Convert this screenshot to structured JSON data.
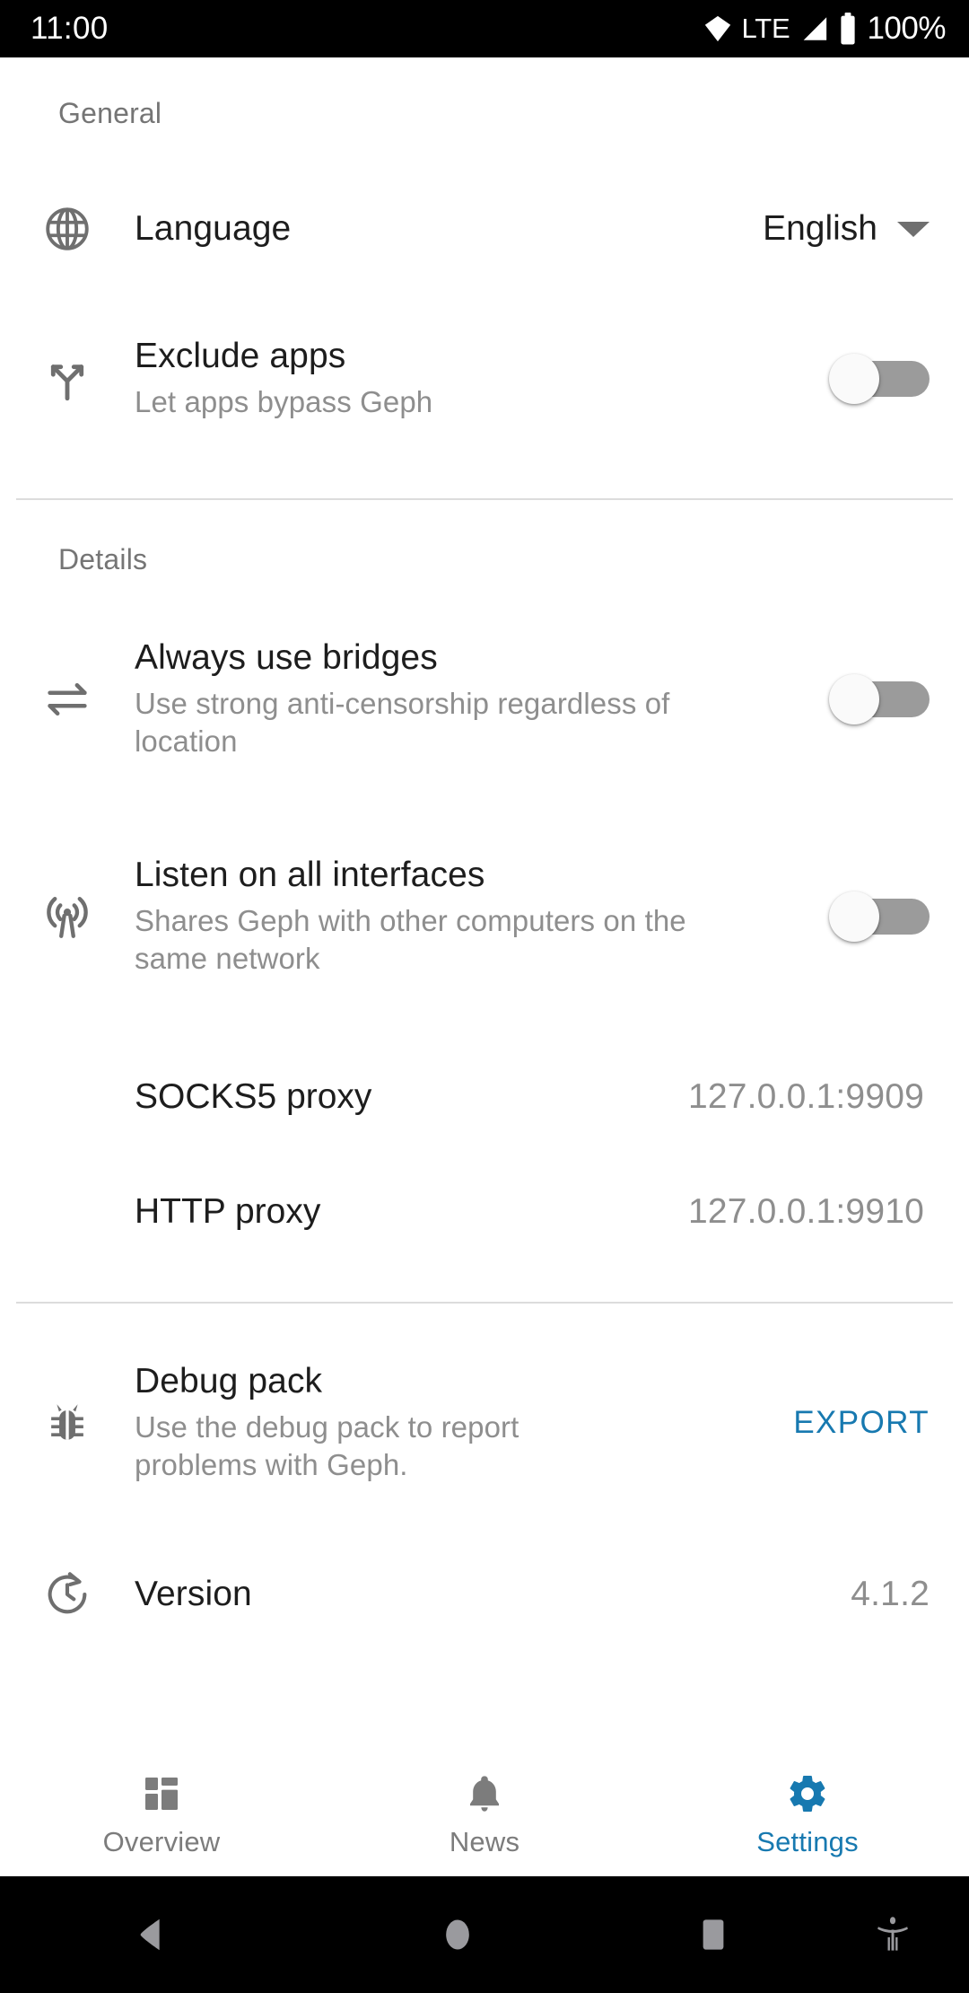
{
  "status_bar": {
    "time": "11:00",
    "network_type": "LTE",
    "battery_percent": "100%",
    "icons": [
      "wifi-icon",
      "signal-icon",
      "battery-icon"
    ]
  },
  "sections": [
    {
      "label": "General",
      "rows": [
        {
          "icon": "globe-icon",
          "title": "Language",
          "value": "English",
          "control": "dropdown"
        },
        {
          "icon": "call-split-icon",
          "title": "Exclude apps",
          "subtitle": "Let apps bypass Geph",
          "control": "switch",
          "checked": false
        }
      ]
    },
    {
      "label": "Details",
      "rows": [
        {
          "icon": "swap-horizontal-icon",
          "title": "Always use bridges",
          "subtitle": "Use strong anti-censorship regardless of location",
          "control": "switch",
          "checked": false
        },
        {
          "icon": "broadcast-icon",
          "title": "Listen on all interfaces",
          "subtitle": "Shares Geph with other computers on the same network",
          "control": "switch",
          "checked": false
        },
        {
          "title": "SOCKS5 proxy",
          "value": "127.0.0.1:9909",
          "control": "text"
        },
        {
          "title": "HTTP proxy",
          "value": "127.0.0.1:9910",
          "control": "text"
        }
      ]
    },
    {
      "rows": [
        {
          "icon": "bug-icon",
          "title": "Debug pack",
          "subtitle": "Use the debug pack to report problems with Geph.",
          "action_label": "EXPORT",
          "control": "action"
        },
        {
          "icon": "update-icon",
          "title": "Version",
          "value": "4.1.2",
          "control": "text"
        }
      ]
    }
  ],
  "bottom_nav": {
    "items": [
      {
        "label": "Overview",
        "icon": "dashboard-icon",
        "active": false
      },
      {
        "label": "News",
        "icon": "bell-icon",
        "active": false
      },
      {
        "label": "Settings",
        "icon": "gear-icon",
        "active": true
      }
    ]
  },
  "android_nav": {
    "back": "back-triangle-icon",
    "home": "home-circle-icon",
    "recents": "recents-square-icon",
    "accessibility": "accessibility-icon"
  },
  "colors": {
    "accent": "#1779b0",
    "title_text": "#1d1d1d",
    "secondary_text": "#8e8e8e",
    "section_label": "#757575",
    "icon": "#6f6f6f",
    "switch_track_off": "#9b9b9b",
    "switch_knob": "#fafafa",
    "divider": "#dcdcdc",
    "status_bar_bg": "#000000",
    "background": "#ffffff"
  }
}
